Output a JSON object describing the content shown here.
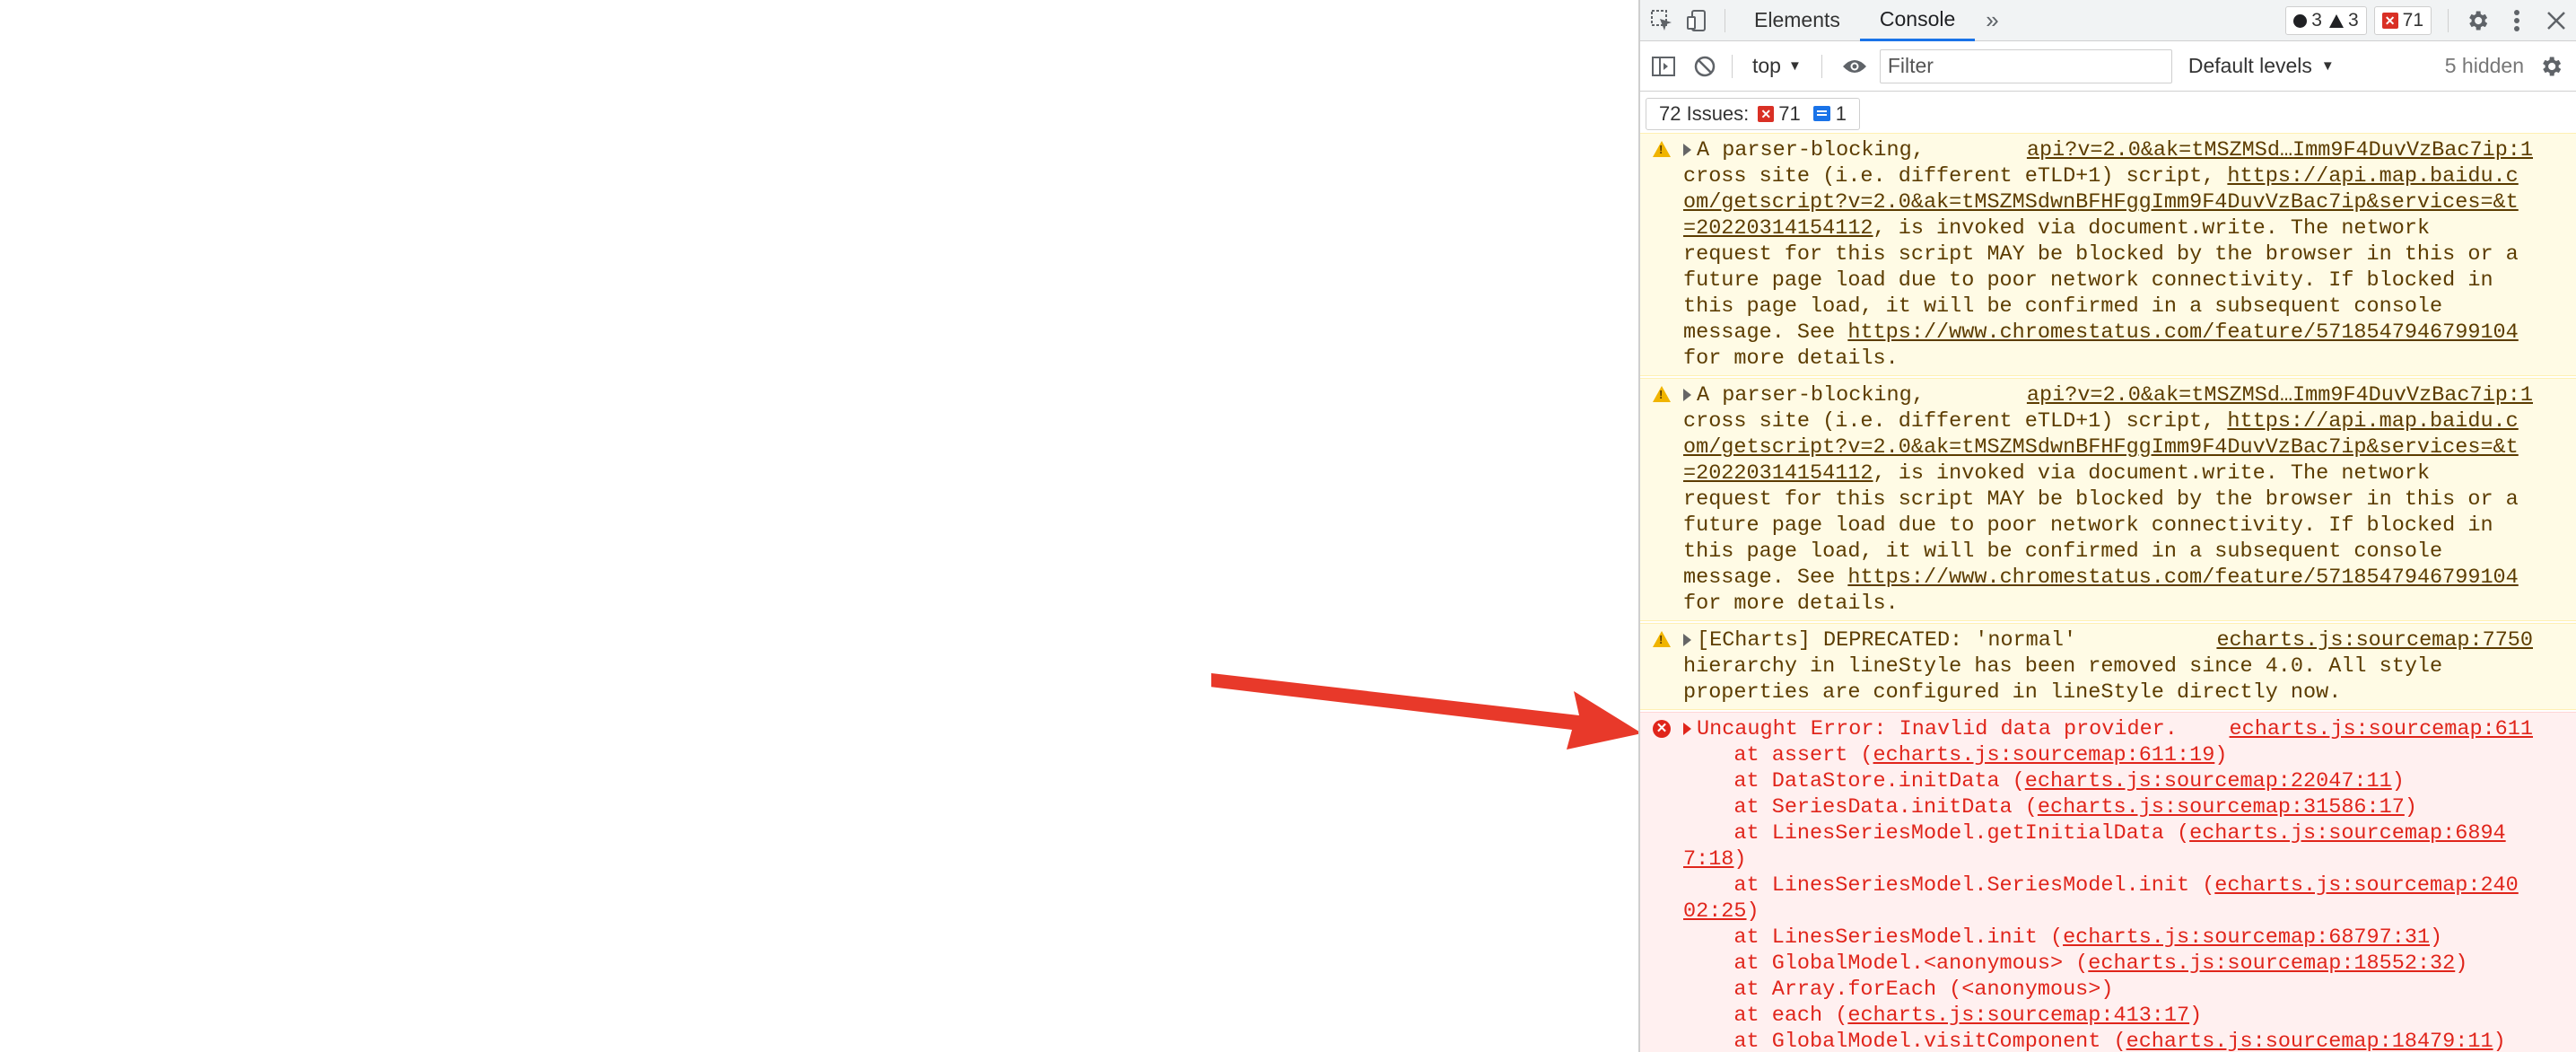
{
  "tabbar": {
    "tabs": [
      "Elements",
      "Console"
    ],
    "active_tab": "Console",
    "counts": {
      "messages": "3",
      "warnings": "3",
      "errors": "71"
    }
  },
  "toolbar": {
    "context": "top",
    "filter_placeholder": "Filter",
    "levels": "Default levels",
    "hidden": "5 hidden"
  },
  "issues": {
    "label": "72 Issues:",
    "errors": "71",
    "info": "1"
  },
  "messages": [
    {
      "type": "warning",
      "source": "api?v=2.0&ak=tMSZMSd…Imm9F4DuvVzBac7ip:1",
      "lines": [
        "A parser-blocking,",
        "cross site (i.e. different eTLD+1) script, https://api.map.baidu.c",
        "om/getscript?v=2.0&ak=tMSZMSdwnBFHFggImm9F4DuvVzBac7ip&services=&t",
        "=20220314154112, is invoked via document.write. The network",
        "request for this script MAY be blocked by the browser in this or a",
        "future page load due to poor network connectivity. If blocked in",
        "this page load, it will be confirmed in a subsequent console",
        "message. See https://www.chromestatus.com/feature/5718547946799104",
        "for more details."
      ]
    },
    {
      "type": "warning",
      "source": "api?v=2.0&ak=tMSZMSd…Imm9F4DuvVzBac7ip:1",
      "lines": [
        "A parser-blocking,",
        "cross site (i.e. different eTLD+1) script, https://api.map.baidu.c",
        "om/getscript?v=2.0&ak=tMSZMSdwnBFHFggImm9F4DuvVzBac7ip&services=&t",
        "=20220314154112, is invoked via document.write. The network",
        "request for this script MAY be blocked by the browser in this or a",
        "future page load due to poor network connectivity. If blocked in",
        "this page load, it will be confirmed in a subsequent console",
        "message. See https://www.chromestatus.com/feature/5718547946799104",
        "for more details."
      ]
    },
    {
      "type": "warning",
      "source": "echarts.js:sourcemap:7750",
      "lines": [
        "[ECharts] DEPRECATED: 'normal'",
        "hierarchy in lineStyle has been removed since 4.0. All style",
        "properties are configured in lineStyle directly now."
      ]
    },
    {
      "type": "error",
      "source": "echarts.js:sourcemap:611",
      "lines": [
        "Uncaught Error: Inavlid data provider.",
        "    at assert (echarts.js:sourcemap:611:19)",
        "    at DataStore.initData (echarts.js:sourcemap:22047:11)",
        "    at SeriesData.initData (echarts.js:sourcemap:31586:17)",
        "    at LinesSeriesModel.getInitialData (echarts.js:sourcemap:6894",
        "7:18)",
        "    at LinesSeriesModel.SeriesModel.init (echarts.js:sourcemap:240",
        "02:25)",
        "    at LinesSeriesModel.init (echarts.js:sourcemap:68797:31)",
        "    at GlobalModel.<anonymous> (echarts.js:sourcemap:18552:32)",
        "    at Array.forEach (<anonymous>)",
        "    at each (echarts.js:sourcemap:413:17)",
        "    at GlobalModel.visitComponent (echarts.js:sourcemap:18479:11)"
      ]
    }
  ],
  "colors": {
    "accent": "#1a73e8",
    "error": "#e0251b",
    "warning_bg": "#fffbe5",
    "error_bg": "#fff0f0",
    "arrow": "#e8392a"
  }
}
